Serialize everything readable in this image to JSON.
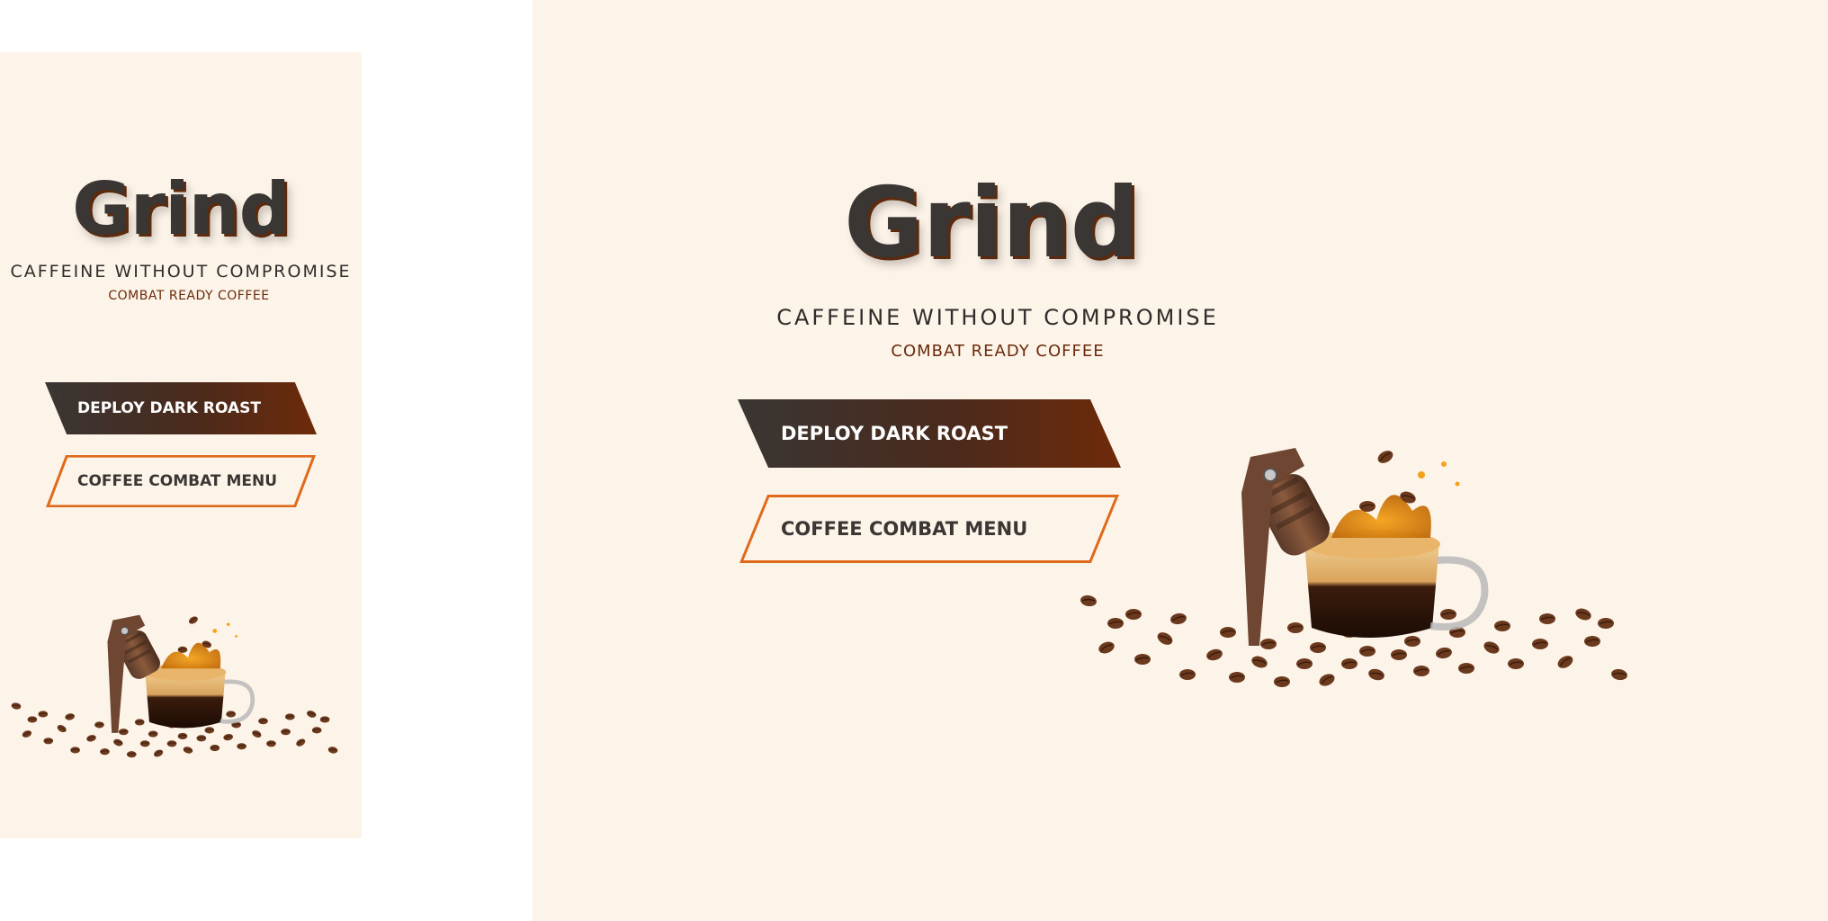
{
  "brand": {
    "title": "Grind",
    "tagline": "CAFFEINE WITHOUT COMPROMISE",
    "subtitle": "COMBAT READY COFFEE"
  },
  "buttons": {
    "primary": "DEPLOY DARK ROAST",
    "secondary": "COFFEE COMBAT MENU"
  },
  "colors": {
    "background": "#fdf4e9",
    "text_dark": "#3a3634",
    "accent_brown": "#6b2a0b",
    "gradient_start": "#3a3634",
    "gradient_end": "#6e2a09",
    "outline_orange": "#e06a1b"
  },
  "icons": {
    "hero": "grenade-coffee-cup-illustration"
  }
}
